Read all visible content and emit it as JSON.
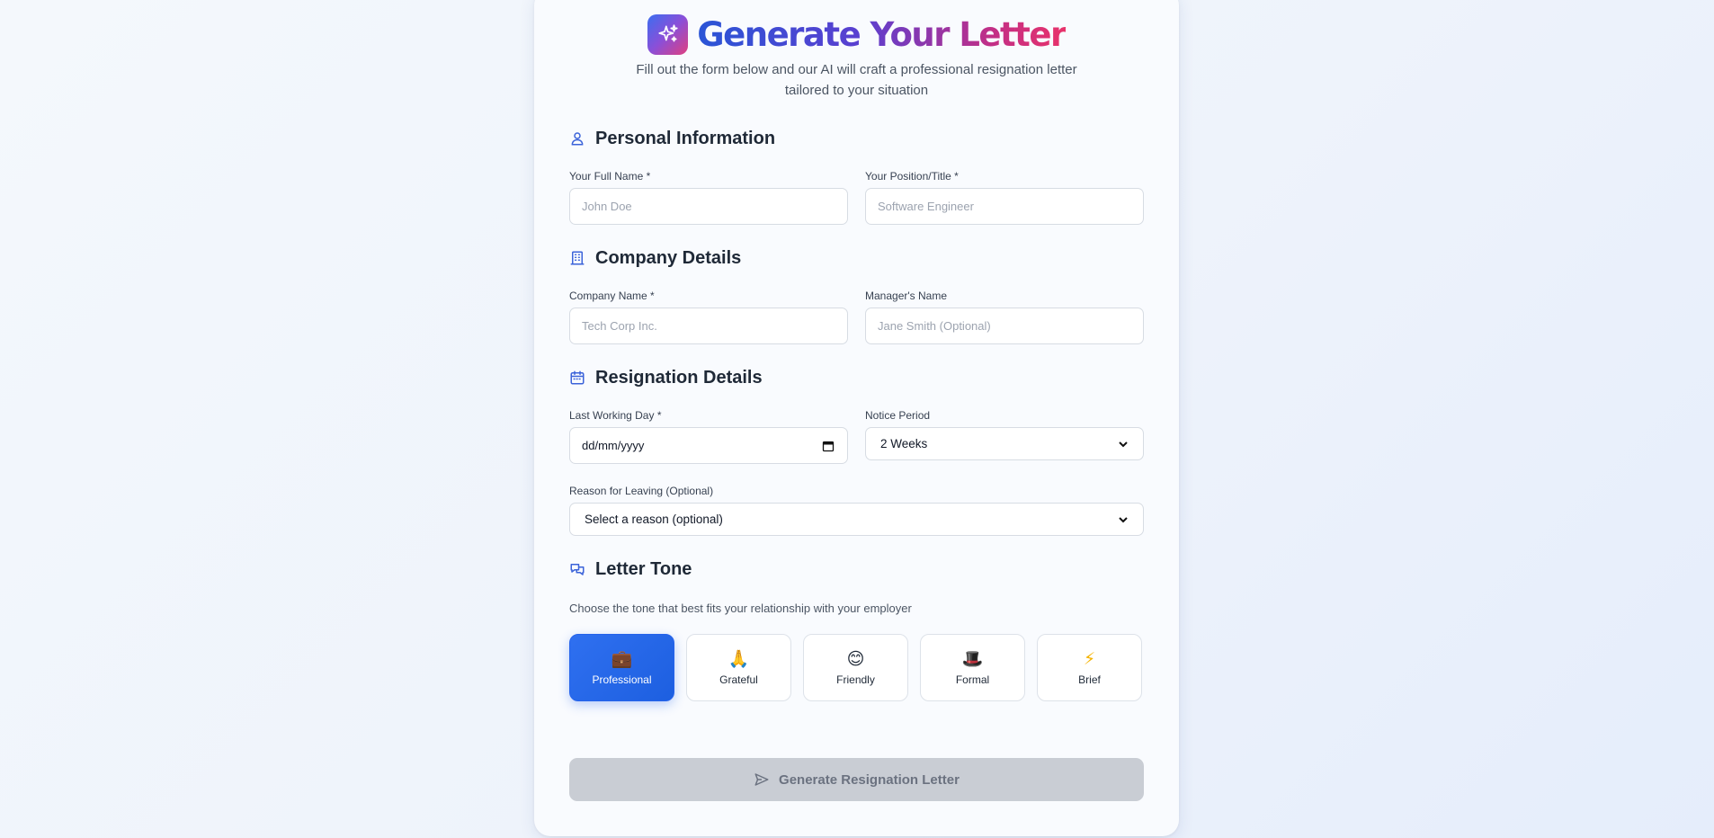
{
  "header": {
    "title": "Generate Your Letter",
    "subtitle_line1": "Fill out the form below and our AI will craft a professional resignation letter",
    "subtitle_line2": "tailored to your situation"
  },
  "personal": {
    "title": "Personal Information",
    "full_name_label": "Your Full Name *",
    "full_name_placeholder": "John Doe",
    "position_label": "Your Position/Title *",
    "position_placeholder": "Software Engineer"
  },
  "company": {
    "title": "Company Details",
    "company_label": "Company Name *",
    "company_placeholder": "Tech Corp Inc.",
    "manager_label": "Manager's Name",
    "manager_placeholder": "Jane Smith (Optional)"
  },
  "resignation": {
    "title": "Resignation Details",
    "last_day_label": "Last Working Day *",
    "last_day_value": "dd/mm/yyyy",
    "notice_label": "Notice Period",
    "notice_value": "2 Weeks",
    "reason_label": "Reason for Leaving (Optional)",
    "reason_value": "Select a reason (optional)"
  },
  "tone": {
    "title": "Letter Tone",
    "description": "Choose the tone that best fits your relationship with your employer",
    "options": [
      {
        "label": "Professional",
        "emoji": "💼",
        "selected": true
      },
      {
        "label": "Grateful",
        "emoji": "🙏",
        "selected": false
      },
      {
        "label": "Friendly",
        "emoji": "😊",
        "selected": false
      },
      {
        "label": "Formal",
        "emoji": "🎩",
        "selected": false
      },
      {
        "label": "Brief",
        "emoji": "⚡",
        "selected": false
      }
    ]
  },
  "actions": {
    "generate_label": "Generate Resignation Letter"
  },
  "colors": {
    "accent": "#2563eb",
    "disabled_button": "#c9cdd4",
    "section_icon": "#3b63d9"
  },
  "icons": {
    "logo": "sparkles-icon",
    "personal": "user-icon",
    "company": "building-icon",
    "resignation": "calendar-icon",
    "tone": "chat-bubbles-icon",
    "generate": "send-icon"
  }
}
